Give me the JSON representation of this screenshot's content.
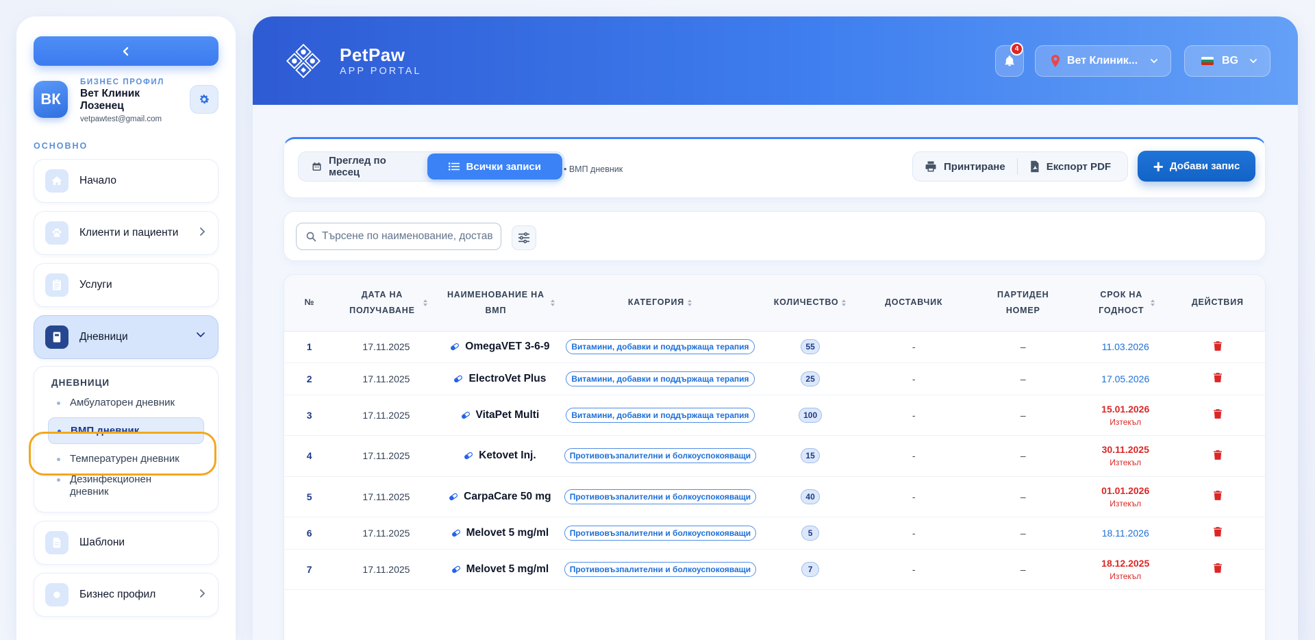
{
  "sidebar": {
    "profile": {
      "initials": "ВК",
      "kicker": "БИЗНЕС ПРОФИЛ",
      "name": "Вет Клиник Лозенец",
      "email": "vetpawtest@gmail.com"
    },
    "section_label": "ОСНОВНО",
    "items": [
      {
        "label": "Начало",
        "icon": "home-icon"
      },
      {
        "label": "Клиенти и пациенти",
        "icon": "paw-icon"
      },
      {
        "label": "Услуги",
        "icon": "clipboard-icon"
      },
      {
        "label": "Дневници",
        "icon": "book-icon"
      }
    ],
    "submenu": {
      "title": "ДНЕВНИЦИ",
      "items": [
        "Амбулаторен дневник",
        "ВМП дневник",
        "Температурен дневник",
        "Дезинфекционен дневник"
      ],
      "active_index": 1
    },
    "bottom_items": [
      {
        "label": "Шаблони",
        "icon": "document-icon"
      },
      {
        "label": "Бизнес профил",
        "icon": "settings-icon"
      }
    ]
  },
  "header": {
    "brand_title": "PetPaw",
    "brand_subtitle": "APP PORTAL",
    "notifications_count": "4",
    "clinic_label": "Вет Клиник...",
    "language": "BG",
    "accent_color": "#3b7bf0"
  },
  "toolbar": {
    "view_month": "Преглед по месец",
    "view_all": "Всички записи",
    "breadcrumb": "• ВМП дневник",
    "print": "Принтиране",
    "export_pdf": "Експорт PDF",
    "add_record": "Добави запис"
  },
  "search": {
    "placeholder": "Търсене по наименование, достав"
  },
  "table": {
    "headers": [
      "№",
      "ДАТА НА ПОЛУЧАВАНЕ",
      "НАИМЕНОВАНИЕ НА ВМП",
      "КАТЕГОРИЯ",
      "КОЛИЧЕСТВО",
      "ДОСТАВЧИК",
      "ПАРТИДЕН НОМЕР",
      "СРОК НА ГОДНОСТ",
      "ДЕЙСТВИЯ"
    ],
    "rows": [
      {
        "no": "1",
        "date": "17.11.2025",
        "name": "OmegaVET 3-6-9",
        "category": "Витамини, добавки и поддържаща терапия",
        "qty": "55",
        "supplier": "-",
        "batch": "–",
        "expiry": "11.03.2026",
        "expired": false,
        "expired_label": ""
      },
      {
        "no": "2",
        "date": "17.11.2025",
        "name": "ElectroVet Plus",
        "category": "Витамини, добавки и поддържаща терапия",
        "qty": "25",
        "supplier": "-",
        "batch": "–",
        "expiry": "17.05.2026",
        "expired": false,
        "expired_label": ""
      },
      {
        "no": "3",
        "date": "17.11.2025",
        "name": "VitaPet Multi",
        "category": "Витамини, добавки и поддържаща терапия",
        "qty": "100",
        "supplier": "-",
        "batch": "–",
        "expiry": "15.01.2026",
        "expired": true,
        "expired_label": "Изтекъл"
      },
      {
        "no": "4",
        "date": "17.11.2025",
        "name": "Ketovet Inj.",
        "category": "Противовъзпалителни и болкоуспокояващи",
        "qty": "15",
        "supplier": "-",
        "batch": "–",
        "expiry": "30.11.2025",
        "expired": true,
        "expired_label": "Изтекъл"
      },
      {
        "no": "5",
        "date": "17.11.2025",
        "name": "CarpaCare 50 mg",
        "category": "Противовъзпалителни и болкоуспокояващи",
        "qty": "40",
        "supplier": "-",
        "batch": "–",
        "expiry": "01.01.2026",
        "expired": true,
        "expired_label": "Изтекъл"
      },
      {
        "no": "6",
        "date": "17.11.2025",
        "name": "Melovet 5 mg/ml",
        "category": "Противовъзпалителни и болкоуспокояващи",
        "qty": "5",
        "supplier": "-",
        "batch": "–",
        "expiry": "18.11.2026",
        "expired": false,
        "expired_label": ""
      },
      {
        "no": "7",
        "date": "17.11.2025",
        "name": "Melovet 5 mg/ml",
        "category": "Противовъзпалителни и болкоуспокояващи",
        "qty": "7",
        "supplier": "-",
        "batch": "–",
        "expiry": "18.12.2025",
        "expired": true,
        "expired_label": "Изтекъл"
      }
    ]
  }
}
